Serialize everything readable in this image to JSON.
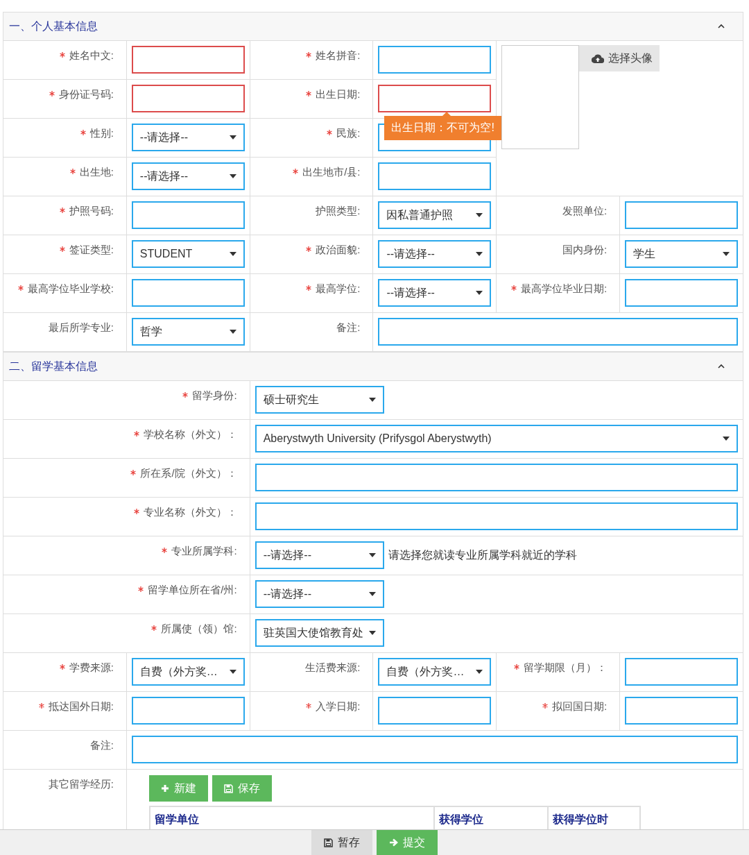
{
  "sections": [
    {
      "title": "一、个人基本信息",
      "expanded": true,
      "photo_button": "选择头像",
      "rows": [
        {
          "kind": "grid",
          "fields": [
            {
              "label": "姓名中文:",
              "required": true,
              "control": {
                "kind": "text",
                "invalid": true
              }
            },
            {
              "label": "姓名拼音:",
              "required": true,
              "control": {
                "kind": "text",
                "invalid": false
              }
            }
          ]
        },
        {
          "kind": "grid",
          "fields": [
            {
              "label": "身份证号码:",
              "required": true,
              "control": {
                "kind": "text",
                "invalid": true
              }
            },
            {
              "label": "出生日期:",
              "required": true,
              "control": {
                "kind": "text",
                "invalid": true,
                "error_tip": "出生日期：不可为空!"
              }
            }
          ]
        },
        {
          "kind": "grid",
          "fields": [
            {
              "label": "性别:",
              "required": true,
              "control": {
                "kind": "select",
                "value": "--请选择--"
              }
            },
            {
              "label": "民族:",
              "required": true,
              "control": {
                "kind": "select"
              }
            }
          ]
        },
        {
          "kind": "grid",
          "fields": [
            {
              "label": "出生地:",
              "required": true,
              "control": {
                "kind": "select",
                "value": "--请选择--"
              }
            },
            {
              "label": "出生地市/县:",
              "required": true,
              "control": {
                "kind": "text",
                "invalid": false
              }
            }
          ]
        },
        {
          "kind": "grid",
          "fields": [
            {
              "label": "护照号码:",
              "required": true,
              "control": {
                "kind": "text",
                "invalid": false
              }
            },
            {
              "label": "护照类型:",
              "required": false,
              "control": {
                "kind": "select",
                "value": "因私普通护照"
              }
            },
            {
              "label": "发照单位:",
              "required": false,
              "control": {
                "kind": "text",
                "invalid": false
              }
            }
          ]
        },
        {
          "kind": "grid",
          "fields": [
            {
              "label": "签证类型:",
              "required": true,
              "control": {
                "kind": "select",
                "value": "STUDENT"
              }
            },
            {
              "label": "政治面貌:",
              "required": true,
              "control": {
                "kind": "select",
                "value": "--请选择--"
              }
            },
            {
              "label": "国内身份:",
              "required": false,
              "control": {
                "kind": "select",
                "value": "学生"
              }
            }
          ]
        },
        {
          "kind": "grid",
          "fields": [
            {
              "label": "最高学位毕业学校:",
              "required": true,
              "control": {
                "kind": "text",
                "invalid": false
              }
            },
            {
              "label": "最高学位:",
              "required": true,
              "control": {
                "kind": "select",
                "value": "--请选择--"
              }
            },
            {
              "label": "最高学位毕业日期:",
              "required": true,
              "control": {
                "kind": "text",
                "invalid": false
              }
            }
          ]
        },
        {
          "kind": "grid",
          "fields": [
            {
              "label": "最后所学专业:",
              "required": false,
              "control": {
                "kind": "select",
                "value": "哲学"
              }
            },
            {
              "label": "备注:",
              "required": false,
              "control": {
                "kind": "text",
                "invalid": false
              }
            }
          ]
        }
      ]
    },
    {
      "title": "二、留学基本信息",
      "expanded": true,
      "rows": [
        {
          "kind": "wide",
          "fields": [
            {
              "label": "留学身份:",
              "required": true,
              "control": {
                "kind": "select",
                "value": "硕士研究生"
              }
            }
          ]
        },
        {
          "kind": "wide",
          "fields": [
            {
              "label": "学校名称（外文）：",
              "required": true,
              "control": {
                "kind": "wide_select",
                "value": "Aberystwyth University (Prifysgol Aberystwyth)"
              }
            }
          ]
        },
        {
          "kind": "wide",
          "fields": [
            {
              "label": "所在系/院（外文）：",
              "required": true,
              "control": {
                "kind": "text",
                "invalid": false
              }
            }
          ]
        },
        {
          "kind": "wide",
          "fields": [
            {
              "label": "专业名称（外文）：",
              "required": true,
              "control": {
                "kind": "text",
                "invalid": false
              }
            }
          ]
        },
        {
          "kind": "wide",
          "fields": [
            {
              "label": "专业所属学科:",
              "required": true,
              "control": {
                "kind": "select",
                "value": "--请选择--",
                "hint": "请选择您就读专业所属学科就近的学科"
              }
            }
          ]
        },
        {
          "kind": "wide",
          "fields": [
            {
              "label": "留学单位所在省/州:",
              "required": true,
              "control": {
                "kind": "select",
                "value": "--请选择--"
              }
            }
          ]
        },
        {
          "kind": "wide",
          "fields": [
            {
              "label": "所属使（领）馆:",
              "required": true,
              "control": {
                "kind": "select",
                "value": "驻英国大使馆教育处"
              }
            }
          ]
        },
        {
          "kind": "grid",
          "fields": [
            {
              "label": "学费来源:",
              "required": true,
              "control": {
                "kind": "select",
                "value": "自费（外方奖…"
              }
            },
            {
              "label": "生活费来源:",
              "required": false,
              "control": {
                "kind": "select",
                "value": "自费（外方奖…"
              }
            },
            {
              "label": "留学期限（月）：",
              "required": true,
              "control": {
                "kind": "text",
                "invalid": false
              }
            }
          ]
        },
        {
          "kind": "grid",
          "fields": [
            {
              "label": "抵达国外日期:",
              "required": true,
              "control": {
                "kind": "text",
                "invalid": false
              }
            },
            {
              "label": "入学日期:",
              "required": true,
              "control": {
                "kind": "text",
                "invalid": false
              }
            },
            {
              "label": "拟回国日期:",
              "required": true,
              "control": {
                "kind": "text",
                "invalid": false
              }
            }
          ]
        },
        {
          "kind": "grid",
          "fields": [
            {
              "label": "备注:",
              "required": false,
              "control": {
                "kind": "text",
                "invalid": false
              }
            }
          ]
        },
        {
          "kind": "history",
          "label": "其它留学经历:",
          "buttons": [
            {
              "label": "新建"
            },
            {
              "label": "保存"
            }
          ],
          "columns": [
            "留学单位",
            "获得学位",
            "获得学位时"
          ]
        }
      ]
    }
  ],
  "footer_buttons": [
    {
      "kind": "secondary",
      "label": "暂存"
    },
    {
      "kind": "primary",
      "label": "提交"
    }
  ]
}
